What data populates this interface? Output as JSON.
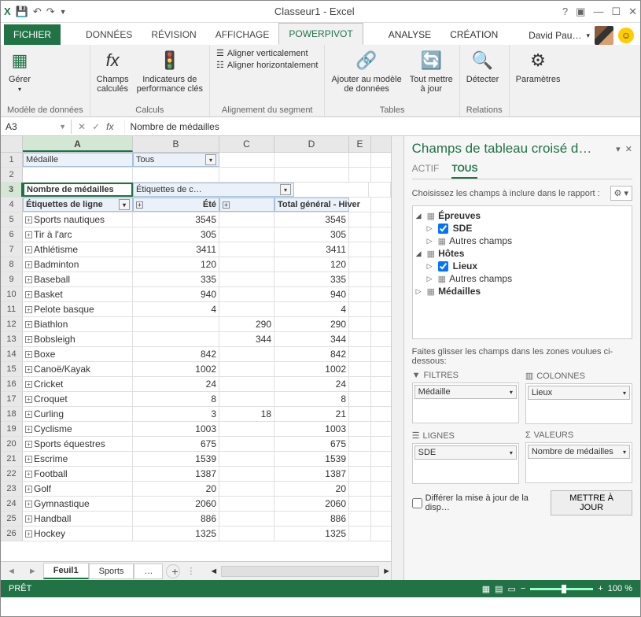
{
  "window": {
    "title": "Classeur1 - Excel"
  },
  "tabs": {
    "file": "FICHIER",
    "items": [
      "DONNÉES",
      "RÉVISION",
      "AFFICHAGE",
      "POWERPIVOT",
      "ANALYSE",
      "CRÉATION"
    ],
    "active": "POWERPIVOT"
  },
  "user": {
    "name": "David Pau…"
  },
  "ribbon": {
    "g1": {
      "label": "Modèle de données",
      "btn": "Gérer"
    },
    "g2": {
      "label": "Calculs",
      "btn1": "Champs\ncalculés",
      "btn2": "Indicateurs de\nperformance clés"
    },
    "g3": {
      "label": "Alignement du segment",
      "r1": "Aligner verticalement",
      "r2": "Aligner horizontalement"
    },
    "g4": {
      "label": "Tables",
      "btn1": "Ajouter au modèle\nde données",
      "btn2": "Tout mettre\nà jour"
    },
    "g5": {
      "label": "Relations",
      "btn": "Détecter"
    },
    "g6": {
      "btn": "Paramètres"
    }
  },
  "namebox": "A3",
  "formula": "Nombre de médailles",
  "cols": [
    "A",
    "B",
    "C",
    "D",
    "E"
  ],
  "pivot": {
    "filterLabel": "Médaille",
    "filterValue": "Tous",
    "dataLabel": "Nombre de médailles",
    "colLabel": "Étiquettes de c…",
    "rowLabel": "Étiquettes de ligne",
    "colH1": "Été",
    "colH2": "",
    "colH3": "Total général",
    "hiver": "- Hiver"
  },
  "rows": [
    {
      "n": 5,
      "l": "Sports nautiques",
      "b": 3545,
      "c": "",
      "d": 3545
    },
    {
      "n": 6,
      "l": "Tir à l'arc",
      "b": 305,
      "c": "",
      "d": 305
    },
    {
      "n": 7,
      "l": "Athlétisme",
      "b": 3411,
      "c": "",
      "d": 3411
    },
    {
      "n": 8,
      "l": "Badminton",
      "b": 120,
      "c": "",
      "d": 120
    },
    {
      "n": 9,
      "l": "Baseball",
      "b": 335,
      "c": "",
      "d": 335
    },
    {
      "n": 10,
      "l": "Basket",
      "b": 940,
      "c": "",
      "d": 940
    },
    {
      "n": 11,
      "l": "Pelote basque",
      "b": 4,
      "c": "",
      "d": 4
    },
    {
      "n": 12,
      "l": "Biathlon",
      "b": "",
      "c": 290,
      "d": 290
    },
    {
      "n": 13,
      "l": "Bobsleigh",
      "b": "",
      "c": 344,
      "d": 344
    },
    {
      "n": 14,
      "l": "Boxe",
      "b": 842,
      "c": "",
      "d": 842
    },
    {
      "n": 15,
      "l": "Canoë/Kayak",
      "b": 1002,
      "c": "",
      "d": 1002
    },
    {
      "n": 16,
      "l": "Cricket",
      "b": 24,
      "c": "",
      "d": 24
    },
    {
      "n": 17,
      "l": "Croquet",
      "b": 8,
      "c": "",
      "d": 8
    },
    {
      "n": 18,
      "l": "Curling",
      "b": 3,
      "c": 18,
      "d": 21
    },
    {
      "n": 19,
      "l": "Cyclisme",
      "b": 1003,
      "c": "",
      "d": 1003
    },
    {
      "n": 20,
      "l": "Sports équestres",
      "b": 675,
      "c": "",
      "d": 675
    },
    {
      "n": 21,
      "l": "Escrime",
      "b": 1539,
      "c": "",
      "d": 1539
    },
    {
      "n": 22,
      "l": "Football",
      "b": 1387,
      "c": "",
      "d": 1387
    },
    {
      "n": 23,
      "l": "Golf",
      "b": 20,
      "c": "",
      "d": 20
    },
    {
      "n": 24,
      "l": "Gymnastique",
      "b": 2060,
      "c": "",
      "d": 2060
    },
    {
      "n": 25,
      "l": "Handball",
      "b": 886,
      "c": "",
      "d": 886
    },
    {
      "n": 26,
      "l": "Hockey",
      "b": 1325,
      "c": "",
      "d": 1325
    }
  ],
  "sheets": {
    "active": "Feuil1",
    "s2": "Sports",
    "more": "…"
  },
  "taskpane": {
    "title": "Champs de tableau croisé d…",
    "tab1": "ACTIF",
    "tab2": "TOUS",
    "instr": "Choisissez les champs à inclure dans le rapport :",
    "fields": {
      "t1": "Épreuves",
      "t1f1": "SDE",
      "autres": "Autres champs",
      "t2": "Hôtes",
      "t2f1": "Lieux",
      "t3": "Médailles"
    },
    "dragInstr": "Faites glisser les champs dans les zones voulues ci-dessous:",
    "zFilters": "FILTRES",
    "zCols": "COLONNES",
    "zRows": "LIGNES",
    "zVals": "VALEURS",
    "iFilter": "Médaille",
    "iCol": "Lieux",
    "iRow": "SDE",
    "iVal": "Nombre de médailles",
    "defer": "Différer la mise à jour de la disp…",
    "update": "METTRE À JOUR"
  },
  "status": {
    "ready": "PRÊT",
    "zoom": "100 %"
  }
}
